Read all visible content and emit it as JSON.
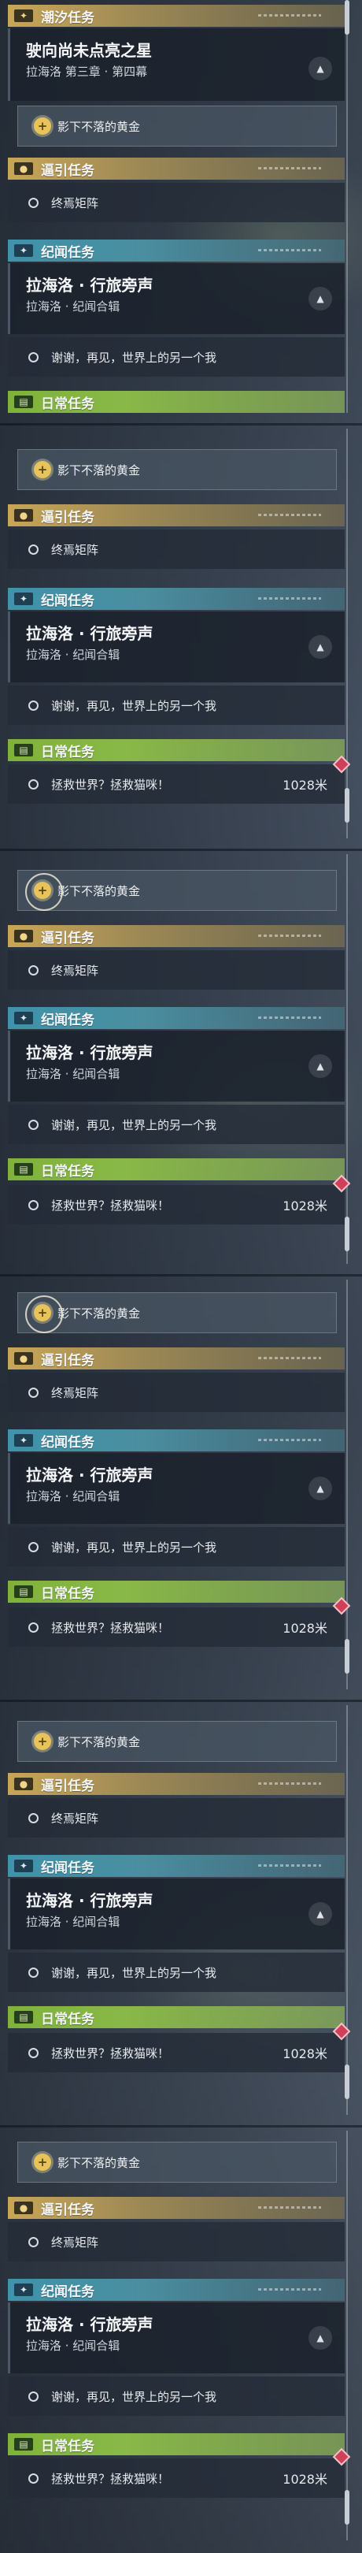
{
  "header": {
    "title": "潮汐任务",
    "quest": "驶向尚未点亮之星",
    "chapter": "拉海洛 第三章 · 第四幕"
  },
  "tracked": {
    "label": "影下不落的黄金",
    "icon": "quest-marker-icon"
  },
  "sections": {
    "guide": {
      "title": "逼引任务",
      "badge_icon": "location-pin-icon",
      "item": "终焉矩阵"
    },
    "story": {
      "title": "纪闻任务",
      "badge_icon": "sparkle-icon",
      "quest": "拉海洛 · 行旅旁声",
      "sub": "拉海洛 · 纪闻合辑",
      "item": "谢谢，再见，世界上的另一个我"
    },
    "daily": {
      "title": "日常任务",
      "badge_icon": "book-icon",
      "item": "拯救世界？拯救猫咪！",
      "distance": "1028米"
    }
  },
  "colors": {
    "yellow": "#c8a657",
    "cyan": "#3f93aa",
    "green": "#7fb23a",
    "alert": "#d0405a"
  }
}
